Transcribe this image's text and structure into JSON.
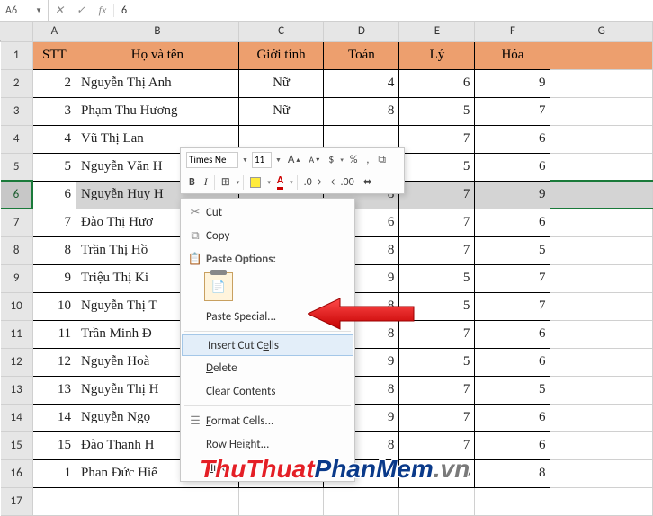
{
  "formula_bar": {
    "name_box": "A6",
    "cancel": "✕",
    "enter": "✓",
    "fx": "fx",
    "value": "6"
  },
  "col_headers": [
    "",
    "A",
    "B",
    "C",
    "D",
    "E",
    "F",
    "G"
  ],
  "header_row": {
    "stt": "STT",
    "name": "Họ và tên",
    "sex": "Giới tính",
    "math": "Toán",
    "phy": "Lý",
    "chem": "Hóa"
  },
  "rows": [
    {
      "n": 2,
      "name": "Nguyễn Thị Anh",
      "sex": "Nữ",
      "math": 4,
      "phy": 6,
      "chem": 9
    },
    {
      "n": 3,
      "name": "Phạm Thu Hương",
      "sex": "Nữ",
      "math": 8,
      "phy": 5,
      "chem": 7
    },
    {
      "n": 4,
      "name": "Vũ Thị Lan",
      "sex": "",
      "math": "",
      "phy": 7,
      "chem": 6
    },
    {
      "n": 5,
      "name": "Nguyễn Văn H",
      "sex": "",
      "math": "",
      "phy": 5,
      "chem": 6
    },
    {
      "n": 6,
      "name": "Nguyễn Huy H",
      "sex": "",
      "math": 8,
      "phy": 7,
      "chem": 9
    },
    {
      "n": 7,
      "name": "Đào Thị Hươ",
      "sex": "",
      "math": 6,
      "phy": 7,
      "chem": 6
    },
    {
      "n": 8,
      "name": "Trần Thị Hồ",
      "sex": "",
      "math": 8,
      "phy": 7,
      "chem": 5
    },
    {
      "n": 9,
      "name": "Triệu Thị Ki",
      "sex": "",
      "math": 9,
      "phy": 5,
      "chem": 7
    },
    {
      "n": 10,
      "name": "Nguyễn Thị T",
      "sex": "",
      "math": 8,
      "phy": 5,
      "chem": 7
    },
    {
      "n": 11,
      "name": "Trần Minh Đ",
      "sex": "",
      "math": 8,
      "phy": 7,
      "chem": 6
    },
    {
      "n": 12,
      "name": "Nguyễn Hoà",
      "sex": "",
      "math": 9,
      "phy": 5,
      "chem": 6
    },
    {
      "n": 13,
      "name": "Nguyễn Thị H",
      "sex": "",
      "math": 8,
      "phy": 7,
      "chem": 5
    },
    {
      "n": 14,
      "name": "Nguyễn Ngọ",
      "sex": "",
      "math": 9,
      "phy": 7,
      "chem": 6
    },
    {
      "n": 15,
      "name": "Đào Thanh H",
      "sex": "",
      "math": 8,
      "phy": 7,
      "chem": 6
    },
    {
      "n": 1,
      "name": "Phan Đức Hiế",
      "sex": "",
      "math": 7,
      "phy": 5,
      "chem": 8
    }
  ],
  "row_labels": [
    "1",
    "2",
    "3",
    "4",
    "5",
    "6",
    "7",
    "8",
    "9",
    "10",
    "11",
    "12",
    "13",
    "14",
    "15",
    "16",
    "17"
  ],
  "mini_toolbar": {
    "font": "Times Ne",
    "size": "11",
    "inc_font": "A",
    "dec_font": "A",
    "currency": "$",
    "percent": "%",
    "comma": ",",
    "format_painter": "⧉",
    "bold": "B",
    "italic": "I",
    "border": "⊞"
  },
  "context_menu": {
    "cut": "Cut",
    "copy": "Copy",
    "paste_hdr": "Paste Options:",
    "paste_special": "Paste Special...",
    "insert_label": "Insert Cut Cells",
    "insert_html": "Insert Cut C<u class='ak'>e</u>lls",
    "delete": "Delete",
    "clear": "Clear Contents",
    "format": "Format Cells...",
    "rowh": "Row Height...",
    "hide": "Hide"
  },
  "watermark": {
    "a": "ThuThuat",
    "b": "PhanMem",
    "c": ".vn"
  }
}
